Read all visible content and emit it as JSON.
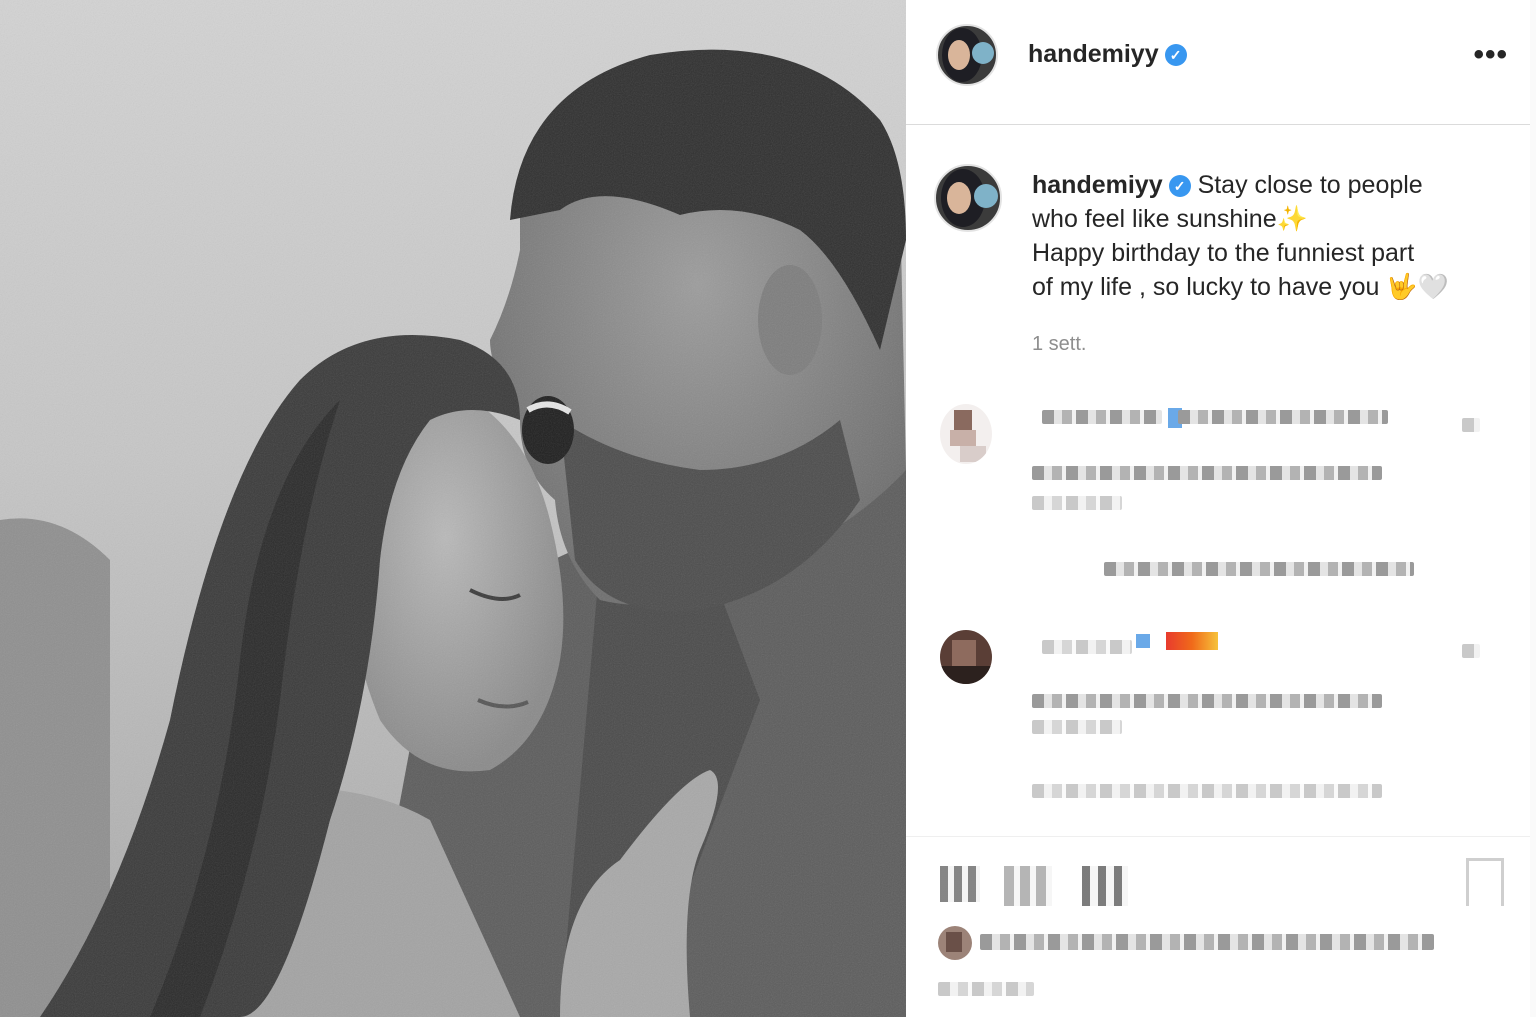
{
  "post": {
    "image_alt": "Black and white photo of a couple",
    "author": {
      "username": "handemiyy",
      "verified_mark": "✓"
    },
    "more_icon": "•••",
    "caption": {
      "username": "handemiyy",
      "line1": "Stay close to people",
      "line2": "who feel like sunshine",
      "sparkle": "✨",
      "line3": "Happy birthday to the funniest part",
      "line4": "of my life , so lucky to have you",
      "emojis": "🤟🤍"
    },
    "timestamp": "1 sett."
  },
  "colors": {
    "verified": "#3897f0",
    "text": "#262626",
    "muted": "#8e8e8e",
    "divider": "#dbdbdb"
  },
  "icons": [
    "verified-badge-icon",
    "more-options-icon",
    "heart-icon",
    "comment-icon",
    "share-icon",
    "bookmark-icon"
  ]
}
